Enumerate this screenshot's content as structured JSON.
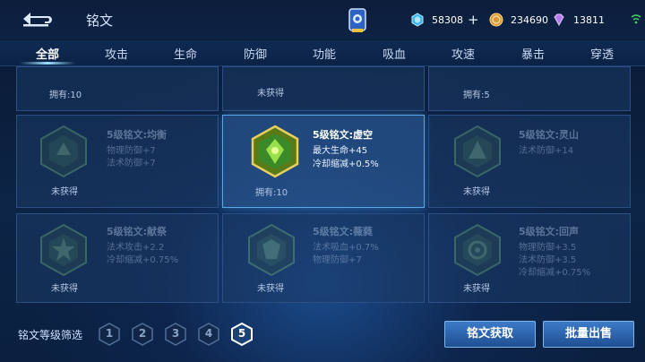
{
  "header": {
    "title": "铭文",
    "resources": [
      {
        "icon": "diamond-icon",
        "value": "58308",
        "color": "#5fd0ff"
      },
      {
        "icon": "gold-coin-icon",
        "value": "234690",
        "color": "#e0a040"
      },
      {
        "icon": "gem-icon",
        "value": "13811",
        "color": "#c080ff"
      }
    ]
  },
  "tabs": [
    {
      "label": "全部",
      "active": true
    },
    {
      "label": "攻击"
    },
    {
      "label": "生命"
    },
    {
      "label": "防御"
    },
    {
      "label": "功能"
    },
    {
      "label": "吸血"
    },
    {
      "label": "攻速"
    },
    {
      "label": "暴击"
    },
    {
      "label": "穿透"
    }
  ],
  "cards_top": [
    {
      "owned": "拥有:10"
    },
    {
      "owned": "未获得"
    },
    {
      "owned": "拥有:5"
    }
  ],
  "cards": [
    {
      "title": "5级铭文:均衡",
      "stats": [
        "物理防御+7",
        "法术防御+7"
      ],
      "owned": "未获得",
      "dim": true,
      "color": "#6fb07a"
    },
    {
      "title": "5级铭文:虚空",
      "stats": [
        "最大生命+45",
        "冷却缩减+0.5%"
      ],
      "owned": "拥有:10",
      "selected": true,
      "color": "#8fd23a"
    },
    {
      "title": "5级铭文:灵山",
      "stats": [
        "法术防御+14"
      ],
      "owned": "未获得",
      "dim": true,
      "color": "#6fb07a"
    },
    {
      "title": "5级铭文:献祭",
      "stats": [
        "法术攻击+2.2",
        "冷却缩减+0.75%"
      ],
      "owned": "未获得",
      "dim": true,
      "color": "#6fb07a"
    },
    {
      "title": "5级铭文:薇蕤",
      "stats": [
        "法术吸血+0.7%",
        "物理防御+7"
      ],
      "owned": "未获得",
      "dim": true,
      "color": "#6fb07a"
    },
    {
      "title": "5级铭文:回声",
      "stats": [
        "物理防御+3.5",
        "法术防御+3.5",
        "冷却缩减+0.75%"
      ],
      "owned": "未获得",
      "dim": true,
      "color": "#6fb07a"
    }
  ],
  "filter": {
    "label": "铭文等级筛选",
    "levels": [
      "1",
      "2",
      "3",
      "4",
      "5"
    ],
    "active": "5"
  },
  "buttons": {
    "acquire": "铭文获取",
    "sell": "批量出售"
  }
}
